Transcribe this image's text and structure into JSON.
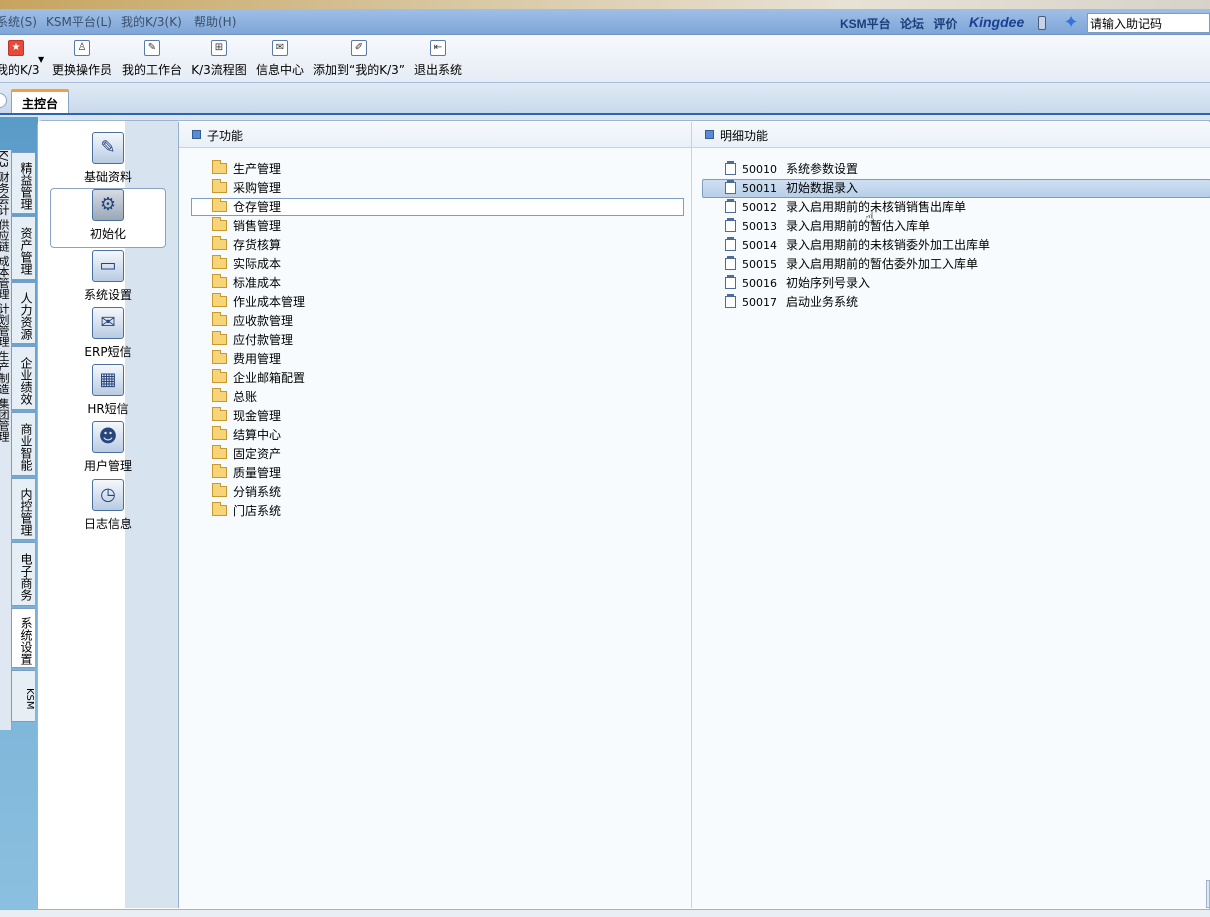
{
  "menubar": {
    "items": [
      "系统(S)",
      "KSM平台(L)",
      "我的K/3(K)",
      "帮助(H)"
    ],
    "right_links": [
      "KSM平台",
      "论坛",
      "评价"
    ],
    "brand": "Kingdee",
    "assist_placeholder": "请输入助记码"
  },
  "toolbar": {
    "buttons": [
      "我的K/3",
      "更换操作员",
      "我的工作台",
      "K/3流程图",
      "信息中心",
      "添加到“我的K/3”",
      "退出系统"
    ]
  },
  "tabs": {
    "main": "主控台"
  },
  "vtabs": [
    "精益管理",
    "资产管理",
    "人力资源",
    "企业绩效",
    "商业智能",
    "内控管理",
    "电子商务",
    "系统设置",
    "KSM"
  ],
  "left_cut": "K/3 财务会计 供应链 成本管理 计划管理 生产制造 集团管理",
  "big_items": [
    "基础资料",
    "初始化",
    "系统设置",
    "ERP短信",
    "HR短信",
    "用户管理",
    "日志信息"
  ],
  "sub_panel": {
    "header": "子功能",
    "items": [
      "生产管理",
      "采购管理",
      "仓存管理",
      "销售管理",
      "存货核算",
      "实际成本",
      "标准成本",
      "作业成本管理",
      "应收款管理",
      "应付款管理",
      "费用管理",
      "企业邮箱配置",
      "总账",
      "现金管理",
      "结算中心",
      "固定资产",
      "质量管理",
      "分销系统",
      "门店系统"
    ],
    "selected": "仓存管理"
  },
  "detail_panel": {
    "header": "明细功能",
    "items": [
      {
        "code": "50010",
        "label": "系统参数设置"
      },
      {
        "code": "50011",
        "label": "初始数据录入"
      },
      {
        "code": "50012",
        "label": "录入启用期前的未核销销售出库单"
      },
      {
        "code": "50013",
        "label": "录入启用期前的暂估入库单"
      },
      {
        "code": "50014",
        "label": "录入启用期前的未核销委外加工出库单"
      },
      {
        "code": "50015",
        "label": "录入启用期前的暂估委外加工入库单"
      },
      {
        "code": "50016",
        "label": "初始序列号录入"
      },
      {
        "code": "50017",
        "label": "启动业务系统"
      }
    ],
    "selected": "50011"
  }
}
